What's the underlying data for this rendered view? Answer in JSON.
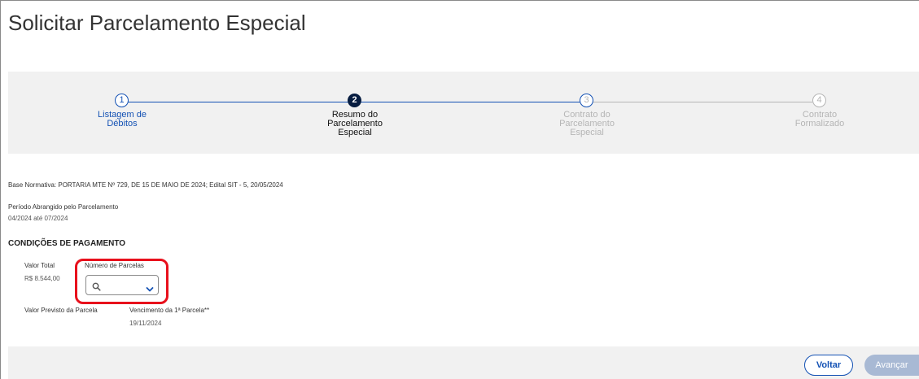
{
  "page": {
    "title": "Solicitar Parcelamento Especial"
  },
  "stepper": {
    "steps": [
      {
        "number": "1",
        "label_lines": [
          "Listagem de",
          "Débitos"
        ],
        "state": "completed"
      },
      {
        "number": "2",
        "label_lines": [
          "Resumo do",
          "Parcelamento",
          "Especial"
        ],
        "state": "active"
      },
      {
        "number": "3",
        "label_lines": [
          "Contrato do",
          "Parcelamento",
          "Especial"
        ],
        "state": "pending"
      },
      {
        "number": "4",
        "label_lines": [
          "Contrato",
          "Formalizado"
        ],
        "state": "pending"
      }
    ]
  },
  "info": {
    "base_normativa_label": "Base Normativa",
    "base_normativa_value": ": PORTARIA MTE Nº 729, DE 15 DE MAIO DE 2024; Edital SIT - 5, 20/05/2024",
    "periodo_label": "Período Abrangido pelo Parcelamento",
    "periodo_value": "04/2024 até 07/2024"
  },
  "payment": {
    "heading": "CONDIÇÕES DE PAGAMENTO",
    "valor_total_label": "Valor Total",
    "valor_total_value": "R$ 8.544,00",
    "numero_parcelas_label": "Número de Parcelas",
    "numero_parcelas_value": "",
    "valor_prevision_label": "Valor Previsto da Parcela",
    "vencimento_label": "Vencimento da 1ª Parcela**",
    "vencimento_value": "19/11/2024"
  },
  "footer": {
    "voltar_label": "Voltar",
    "avancar_label": "Avançar"
  },
  "colors": {
    "primary": "#1351b4",
    "active_step": "#071d41",
    "pending": "#b5b5b5",
    "highlight": "#e8101c",
    "disabled_button": "#a8b9d4"
  },
  "icons": {
    "search": "search-icon",
    "dropdown": "chevron-down-icon"
  }
}
